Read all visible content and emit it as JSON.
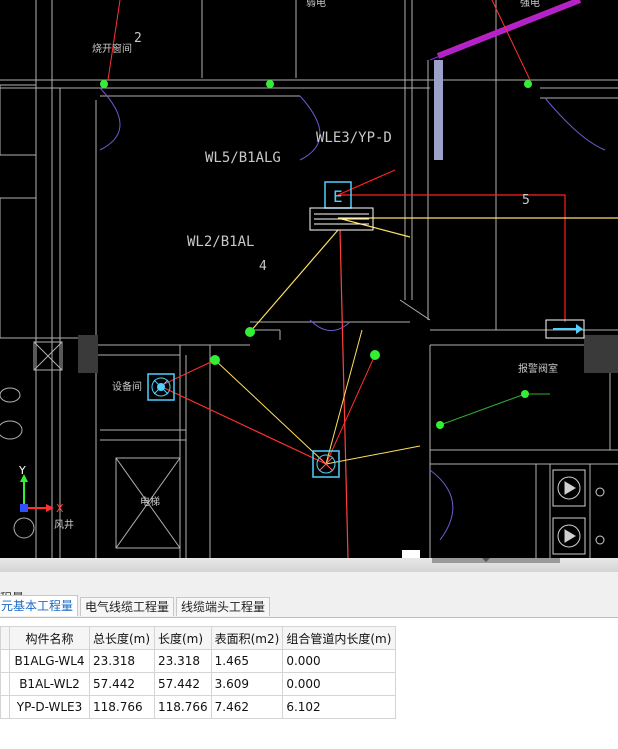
{
  "cad": {
    "labels": {
      "wl5": "WL5/B1ALG",
      "wle3": "WLE3/YP-D",
      "wl2": "WL2/B1AL",
      "num2": "2",
      "num4": "4",
      "num5": "5",
      "room_tl": "烧开窗间",
      "room_equipment": "设备间",
      "room_elevator": "电梯",
      "room_valve": "报警阀室",
      "room_shaft": "风井",
      "room_top": "弱电",
      "room_top_right": "强电"
    },
    "axis": {
      "y": "Y",
      "x": "X"
    },
    "colors": {
      "background": "#000000",
      "wall": "#b8b8b8",
      "cable_red": "#ff2020",
      "cable_yellow": "#ffe060",
      "device": "#4fd0ff",
      "node_green": "#33ee33",
      "purple": "#a020a0"
    }
  },
  "panel": {
    "title": "程量",
    "tabs": [
      {
        "label": "元基本工程量",
        "active": true
      },
      {
        "label": "电气线缆工程量",
        "active": false
      },
      {
        "label": "线缆端头工程量",
        "active": false
      }
    ],
    "columns": [
      "构件名称",
      "总长度(m)",
      "长度(m)",
      "表面积(m2)",
      "组合管道内长度(m)"
    ],
    "rows": [
      [
        "B1ALG-WL4",
        "23.318",
        "23.318",
        "1.465",
        "0.000"
      ],
      [
        "B1AL-WL2",
        "57.442",
        "57.442",
        "3.609",
        "0.000"
      ],
      [
        "YP-D-WLE3",
        "118.766",
        "118.766",
        "7.462",
        "6.102"
      ]
    ]
  }
}
